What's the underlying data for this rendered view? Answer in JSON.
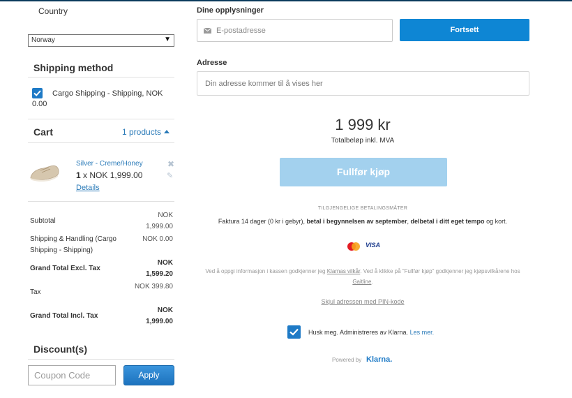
{
  "left": {
    "country_label": "Country",
    "country_value": "Norway",
    "shipping_title": "Shipping method",
    "shipping_option": "Cargo Shipping - Shipping, NOK 0.00",
    "cart_title": "Cart",
    "cart_toggle": "1 products",
    "product": {
      "name": "Silver - Creme/Honey",
      "qty": "1",
      "price": "x NOK 1,999.00",
      "details": "Details"
    },
    "totals": [
      {
        "label": "Subtotal",
        "value": "NOK 1,999.00",
        "bold": false
      },
      {
        "label": "Shipping & Handling (Cargo Shipping - Shipping)",
        "value": "NOK 0.00",
        "bold": false
      },
      {
        "label": "Grand Total Excl. Tax",
        "value": "NOK 1,599.20",
        "bold": true
      },
      {
        "label": "Tax",
        "value": "NOK 399.80",
        "bold": false
      },
      {
        "label": "Grand Total Incl. Tax",
        "value": "NOK 1,999.00",
        "bold": true
      }
    ],
    "discount_title": "Discount(s)",
    "coupon_placeholder": "Coupon Code",
    "apply_label": "Apply"
  },
  "right": {
    "info_title": "Dine opplysninger",
    "email_placeholder": "E-postadresse",
    "continue_label": "Fortsett",
    "address_title": "Adresse",
    "address_placeholder": "Din adresse kommer til å vises her",
    "amount": "1 999 kr",
    "amount_sub": "Totalbeløp inkl. MVA",
    "complete_label": "Fullfør kjøp",
    "payment_head": "TILGJENGELIGE BETALINGSMÅTER",
    "payment_desc_1": "Faktura 14 dager (0 kr i gebyr), ",
    "payment_desc_2": "betal i begynnelsen av september",
    "payment_desc_3": ", ",
    "payment_desc_4": "delbetal i ditt eget tempo",
    "payment_desc_5": " og kort.",
    "visa": "VISA",
    "terms_1": "Ved å oppgi informasjon i kassen godkjenner jeg ",
    "terms_link_1": "Klarnas vilkår",
    "terms_2": ". Ved å klikke på \"Fullfør kjøp\" godkjenner jeg kjøpsvilkårene hos ",
    "terms_link_2": "Gaitline",
    "terms_3": ".",
    "hide_address": "Skjul adressen med PIN-kode",
    "remember_text": "Husk meg. Administreres av Klarna. ",
    "remember_link": "Les mer.",
    "powered_by": "Powered by",
    "klarna": "Klarna."
  },
  "colors": {
    "accent": "#0e86d4",
    "link": "#2a7ab8",
    "disabled_button": "#a3d1ee"
  }
}
